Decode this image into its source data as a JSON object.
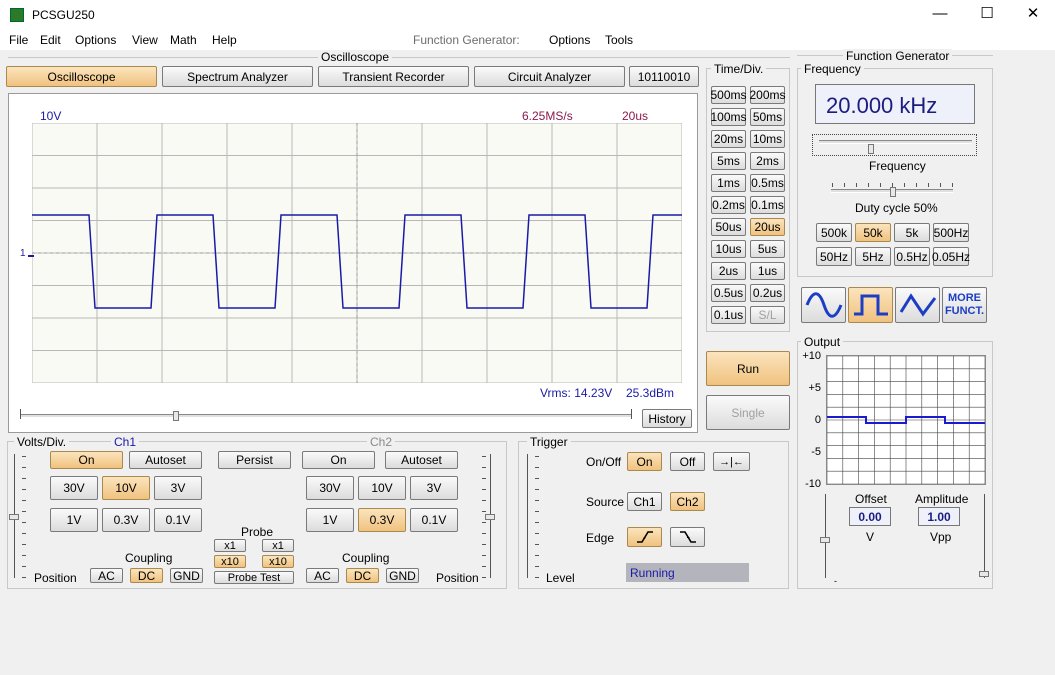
{
  "window": {
    "title": "PCSGU250",
    "min": "—",
    "max": "☐",
    "close": "✕"
  },
  "menu": {
    "file": "File",
    "edit": "Edit",
    "options": "Options",
    "view": "View",
    "math": "Math",
    "help": "Help",
    "fg_label": "Function Generator:",
    "fg_options": "Options",
    "fg_tools": "Tools"
  },
  "oscilloscope": {
    "group_label": "Oscilloscope",
    "tabs": [
      "Oscilloscope",
      "Spectrum Analyzer",
      "Transient Recorder",
      "Circuit Analyzer",
      "10110010"
    ],
    "active_tab": 0,
    "screen": {
      "volts_label": "10V",
      "sample_rate": "6.25MS/s",
      "timebase": "20us",
      "marker": "1",
      "vrms": "Vrms: 14.23V",
      "dbm": "25.3dBm"
    },
    "history": "History",
    "run": "Run",
    "single": "Single"
  },
  "timediv": {
    "label": "Time/Div.",
    "buttons": [
      [
        "500ms",
        "200ms"
      ],
      [
        "100ms",
        "50ms"
      ],
      [
        "20ms",
        "10ms"
      ],
      [
        "5ms",
        "2ms"
      ],
      [
        "1ms",
        "0.5ms"
      ],
      [
        "0.2ms",
        "0.1ms"
      ],
      [
        "50us",
        "20us"
      ],
      [
        "10us",
        "5us"
      ],
      [
        "2us",
        "1us"
      ],
      [
        "0.5us",
        "0.2us"
      ],
      [
        "0.1us",
        "S/L"
      ]
    ],
    "active": "20us",
    "disabled": "S/L"
  },
  "volts": {
    "label": "Volts/Div.",
    "ch1": "Ch1",
    "ch2": "Ch2",
    "on": "On",
    "autoset": "Autoset",
    "persist": "Persist",
    "ranges_top": [
      "30V",
      "10V",
      "3V"
    ],
    "ranges_bottom": [
      "1V",
      "0.3V",
      "0.1V"
    ],
    "ch1_active": "10V",
    "ch2_active": "0.3V",
    "probe": "Probe",
    "x1": "x1",
    "x10": "x10",
    "probe_test": "Probe Test",
    "coupling": "Coupling",
    "ac": "AC",
    "dc": "DC",
    "gnd": "GND",
    "position": "Position"
  },
  "trigger": {
    "label": "Trigger",
    "onoff": "On/Off",
    "on": "On",
    "off": "Off",
    "center_icon": "→|←",
    "source": "Source",
    "ch1": "Ch1",
    "ch2": "Ch2",
    "edge": "Edge",
    "level": "Level",
    "status": "Running"
  },
  "fg": {
    "label": "Function Generator",
    "frequency_label": "Frequency",
    "frequency_value": "20.000 kHz",
    "frequency_slider_label": "Frequency",
    "duty_label": "Duty cycle 50%",
    "range_top": [
      "500k",
      "50k",
      "5k",
      "500Hz"
    ],
    "range_bottom": [
      "50Hz",
      "5Hz",
      "0.5Hz",
      "0.05Hz"
    ],
    "range_active": "50k",
    "more": "MORE FUNCT.",
    "more1": "MORE",
    "more2": "FUNCT.",
    "output_label": "Output",
    "y_ticks": [
      "+10",
      "+5",
      "0",
      "-5",
      "-10"
    ],
    "offset_label": "Offset",
    "offset_value": "0.00",
    "offset_unit": "V",
    "amplitude_label": "Amplitude",
    "amplitude_value": "1.00",
    "amplitude_unit": "Vpp"
  },
  "colors": {
    "trace": "#1a1aa8",
    "active": "#f0c27f",
    "readout_text": "#1c1c80",
    "grid": "#b8b8b8"
  }
}
